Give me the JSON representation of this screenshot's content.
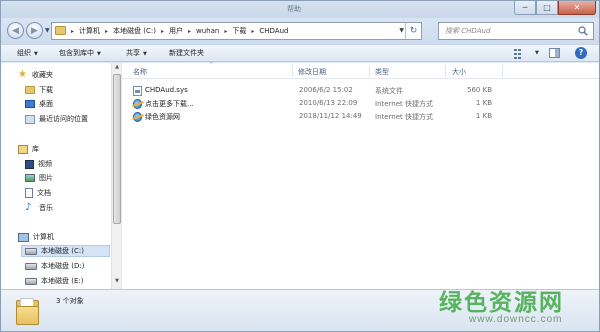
{
  "window": {
    "title": "帮助",
    "minimize_symbol": "─",
    "maximize_symbol": "□",
    "close_symbol": "✕"
  },
  "nav": {
    "back_symbol": "◀",
    "forward_symbol": "▶",
    "dropdown_symbol": "▼",
    "refresh_symbol": "↻",
    "breadcrumb": [
      "计算机",
      "本地磁盘 (C:)",
      "用户",
      "wuhan",
      "下载",
      "CHDAud"
    ],
    "separator": "▸",
    "search_placeholder": "搜索 CHDAud"
  },
  "toolbar": {
    "organize": "组织",
    "include_in_library": "包含到库中",
    "share": "共享",
    "new_folder": "新建文件夹",
    "dropdown_symbol": "▼",
    "help_symbol": "?"
  },
  "sidebar": {
    "favorites": "收藏夹",
    "downloads": "下载",
    "desktop": "桌面",
    "recent": "最近访问的位置",
    "libraries": "库",
    "videos": "视频",
    "pictures": "图片",
    "documents": "文档",
    "music": "音乐",
    "computer": "计算机",
    "drives": [
      {
        "label": "本地磁盘 (C:)",
        "selected": true
      },
      {
        "label": "本地磁盘 (D:)",
        "selected": false
      },
      {
        "label": "本地磁盘 (E:)",
        "selected": false
      }
    ],
    "scroll_up": "▲",
    "scroll_down": "▼"
  },
  "columns": {
    "name": "名称",
    "date": "修改日期",
    "type": "类型",
    "size": "大小",
    "sort_indicator": "^"
  },
  "files": [
    {
      "name": "CHDAud.sys",
      "date": "2006/6/2 15:02",
      "type": "系统文件",
      "size": "560 KB",
      "icon": "sys-file-icon"
    },
    {
      "name": "点击更多下载...",
      "date": "2010/6/13 22:09",
      "type": "Internet 快捷方式",
      "size": "1 KB",
      "icon": "internet-shortcut-icon"
    },
    {
      "name": "绿色资源网",
      "date": "2018/11/12 14:49",
      "type": "Internet 快捷方式",
      "size": "1 KB",
      "icon": "internet-shortcut-icon"
    }
  ],
  "details": {
    "item_count": "3 个对象"
  },
  "watermark": {
    "title": "绿色资源网",
    "url": "www.downcc.com"
  }
}
